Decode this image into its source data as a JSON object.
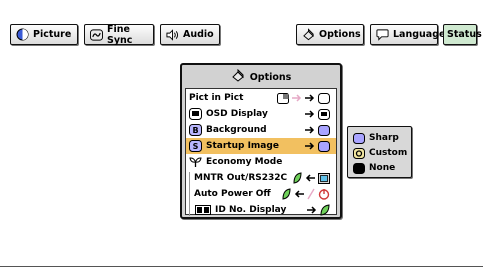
{
  "tabs": [
    {
      "label": "Picture",
      "icon": "picture-icon"
    },
    {
      "label": "Fine Sync",
      "icon": "fine-sync-icon"
    },
    {
      "label": "Audio",
      "icon": "speaker-icon"
    },
    {
      "label": "Options",
      "icon": "options-icon"
    },
    {
      "label": "Language",
      "icon": "speech-bubble-icon"
    },
    {
      "label": "Status"
    }
  ],
  "menu": {
    "title": "Options",
    "items": [
      {
        "label": "Pict in Pict"
      },
      {
        "label": "OSD Display"
      },
      {
        "label": "Background"
      },
      {
        "label": "Startup Image"
      },
      {
        "label": "Economy Mode"
      },
      {
        "label": "MNTR Out/RS232C"
      },
      {
        "label": "Auto Power Off"
      },
      {
        "label": "ID No. Display"
      }
    ]
  },
  "submenu": {
    "options": [
      {
        "label": "Sharp"
      },
      {
        "label": "Custom"
      },
      {
        "label": "None"
      }
    ]
  },
  "colors": {
    "highlight": "#f2c060",
    "menu_bg": "#d2d2d2",
    "status_tab": "#cfe9d0"
  }
}
